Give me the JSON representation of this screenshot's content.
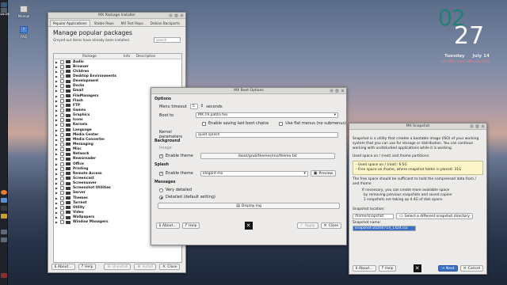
{
  "desktop": {
    "icons": [
      {
        "label": "Manual"
      },
      {
        "label": "FAQ"
      }
    ],
    "panel_time": "14:23"
  },
  "conky": {
    "hours": "02",
    "minutes": "27",
    "day": "Tuesday",
    "date": "July 14",
    "stats_text": "hd 28%  mem 18%  cpu 29%"
  },
  "package_installer": {
    "title": "MX Package Installer",
    "tabs": [
      "Popular Applications",
      "Stable Repo",
      "MX Test Repo",
      "Debian Backports"
    ],
    "heading": "Manage popular packages",
    "note": "Greyed out items have already been installed.",
    "search_placeholder": "search",
    "columns": [
      "Package",
      "Info",
      "Description"
    ],
    "categories": [
      "Audio",
      "Browser",
      "Children",
      "Desktop Environments",
      "Development",
      "Docks",
      "Email",
      "FileManagers",
      "Flash",
      "FTP",
      "Games",
      "Graphics",
      "Icons",
      "Kernels",
      "Language",
      "Media Center",
      "Media Converter",
      "Messaging",
      "Misc",
      "Network",
      "Newsreader",
      "Office",
      "Printing",
      "Remote Access",
      "Screencast",
      "Screensaver",
      "Screenshot Utilities",
      "Server",
      "Themes",
      "Torrent",
      "Utility",
      "Video",
      "Wallpapers",
      "Window Managers"
    ],
    "footer": {
      "about": "About...",
      "help": "Help",
      "uninstall": "Uninstall",
      "install": "Install",
      "close": "Close"
    }
  },
  "boot_options": {
    "title": "MX Boot Options",
    "options_label": "Options",
    "menu_timeout_label": "Menu timeout",
    "menu_timeout_value": "5",
    "seconds_label": "seconds",
    "boot_to_label": "Boot to",
    "boot_to_value": "MX 19 patito feo",
    "enable_saving_label": "Enable saving last boot choice",
    "use_flat_menus_label": "Use flat menus (no submenus)",
    "kernel_params_label": "Kernel parameters",
    "kernel_params_value": "quiet splash",
    "background_label": "Background",
    "image_label": "Image",
    "enable_theme_label": "Enable theme",
    "theme_path": "/boot/grub/themes/mx/theme.txt",
    "splash_label": "Splash",
    "splash_enable_label": "Enable theme",
    "splash_theme_value": "elegant-mx",
    "preview_label": "Preview",
    "messages_label": "Messages",
    "very_detailed_label": "Very detailed",
    "detailed_label": "Detailed (default setting)",
    "display_log_label": "Display log",
    "about_label": "About...",
    "help_label": "Help",
    "apply_label": "Apply",
    "close_label": "Close"
  },
  "snapshot": {
    "title": "MX Snapshot",
    "intro": "Snapshot is a utility that creates a bootable image (ISO) of your working system that you can use for storage or distribution. You can continue working with undisturbed applications while it is working.",
    "used_space_label": "Used space on / (root) and /home partitions:",
    "used_root": "- Used space on / (root): 6.5G",
    "used_home": "- Free space on /home, where snapshot folder is placed: 31G",
    "free_space_note": "The free space should be sufficient to hold the compressed data from / and /home",
    "necessary_lines": [
      "If necessary, you can create more available space",
      "by removing previous snapshots and saved copies:",
      "1 snapshots are taking up 4.4G of disk space."
    ],
    "location_label": "Snapshot location:",
    "location_value": "/home/snapshot",
    "select_dir_label": "Select a different snapshot directory",
    "name_label": "Snapshot name:",
    "name_value": "snapshot-20200714_1424.iso",
    "about_label": "About...",
    "help_label": "Help",
    "next_label": "Next",
    "cancel_label": "Cancel"
  }
}
